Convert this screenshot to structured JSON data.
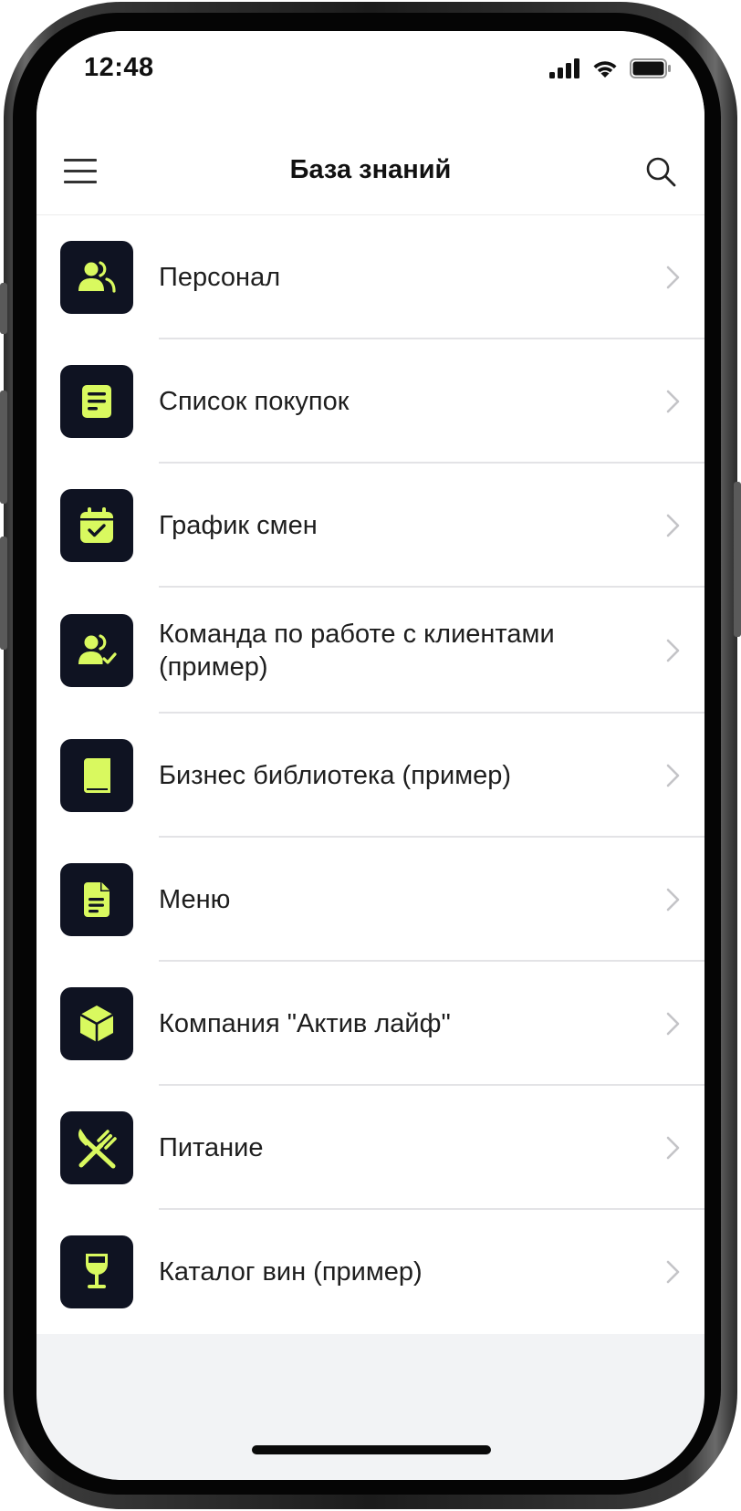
{
  "status_bar": {
    "time": "12:48"
  },
  "nav": {
    "title": "База знаний",
    "menu_icon": "hamburger-menu-icon",
    "search_icon": "search-icon"
  },
  "colors": {
    "icon_background": "#0f1322",
    "icon_accent": "#d9f95f",
    "text": "#1e1e1e",
    "divider": "#e3e3e6",
    "page_background": "#f2f3f5"
  },
  "items": [
    {
      "label": "Персонал",
      "icon": "users-icon"
    },
    {
      "label": "Список покупок",
      "icon": "note-icon"
    },
    {
      "label": "График смен",
      "icon": "calendar-check-icon"
    },
    {
      "label": "Команда по работе с клиентами (пример)",
      "icon": "user-check-icon"
    },
    {
      "label": "Бизнес библиотека (пример)",
      "icon": "book-icon"
    },
    {
      "label": "Меню",
      "icon": "document-icon"
    },
    {
      "label": "Компания \"Актив лайф\"",
      "icon": "cube-icon"
    },
    {
      "label": "Питание",
      "icon": "fork-knife-icon"
    },
    {
      "label": "Каталог вин (пример)",
      "icon": "wine-glass-icon"
    }
  ]
}
